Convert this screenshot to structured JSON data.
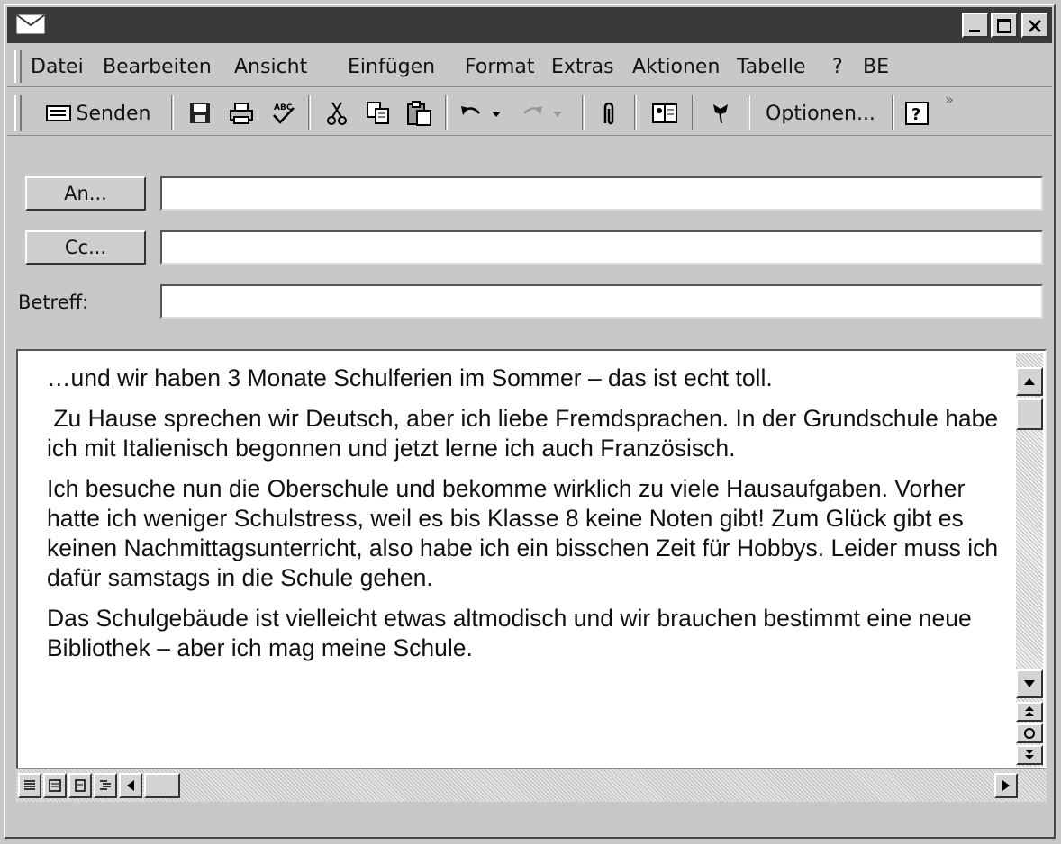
{
  "window": {
    "title_icon": "envelope-icon",
    "controls": [
      "minimize-icon",
      "maximize-icon",
      "close-icon"
    ]
  },
  "menu": {
    "items": [
      {
        "label": "Datei"
      },
      {
        "label": "Bearbeiten"
      },
      {
        "label": "Ansicht"
      },
      {
        "label": "Einfügen"
      },
      {
        "label": "Format"
      },
      {
        "label": "Extras"
      },
      {
        "label": "Aktionen"
      },
      {
        "label": "Tabelle"
      },
      {
        "label": "?"
      },
      {
        "label": "BE"
      }
    ]
  },
  "toolbar": {
    "send_label": "Senden",
    "options_label": "Optionen...",
    "overflow": "»",
    "icons": [
      "save-icon",
      "print-icon",
      "spellcheck-icon",
      "cut-icon",
      "copy-icon",
      "paste-icon",
      "undo-icon",
      "redo-icon",
      "attach-icon",
      "address-book-icon",
      "flag-icon",
      "help-icon"
    ]
  },
  "fields": {
    "to_label": "An...",
    "cc_label": "Cc...",
    "subject_label": "Betreff:",
    "to_value": "",
    "cc_value": "",
    "subject_value": ""
  },
  "body": {
    "paragraphs": [
      "…und wir haben 3 Monate Schulferien im Sommer – das ist echt toll.",
      " Zu Hause sprechen wir Deutsch, aber ich liebe Fremdsprachen. In der Grundschule habe ich mit Italienisch begonnen und jetzt lerne ich auch Französisch.",
      "Ich besuche nun die Oberschule und bekomme wirklich zu viele Hausaufgaben. Vorher hatte ich weniger Schulstress, weil es bis Klasse 8 keine Noten gibt! Zum Glück gibt es keinen Nachmittagsunterricht, also habe ich ein bisschen Zeit für Hobbys. Leider muss ich dafür samstags in die Schule gehen.",
      "Das Schulgebäude ist vielleicht etwas altmodisch und wir brauchen bestimmt eine neue Bibliothek – aber ich mag meine Schule."
    ]
  },
  "colors": {
    "titlebar": "#3a3a3a",
    "chrome": "#c8c8c8",
    "body_bg": "#ffffff"
  }
}
